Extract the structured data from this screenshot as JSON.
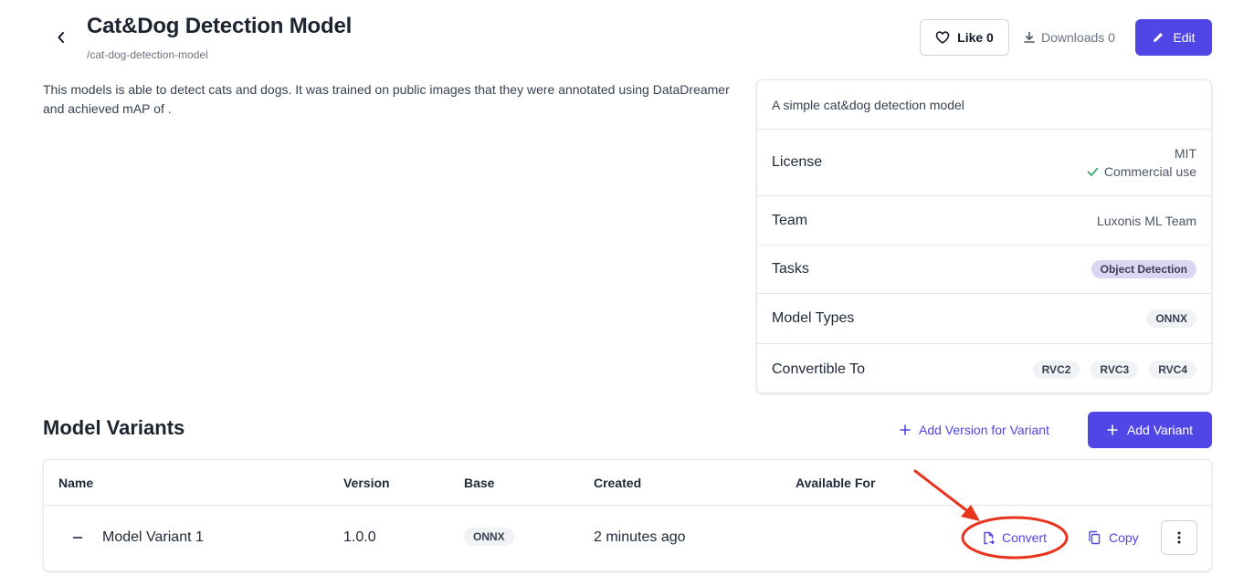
{
  "header": {
    "title": "Cat&Dog Detection Model",
    "slug": "/cat-dog-detection-model",
    "like_label": "Like 0",
    "downloads_label": "Downloads 0",
    "edit_label": "Edit"
  },
  "description": "This models is able to detect cats and dogs. It was trained on public images that they were annotated using DataDreamer and achieved mAP of .",
  "info": {
    "summary": "A simple cat&dog detection model",
    "license_label": "License",
    "license_value": "MIT",
    "commercial_use": "Commercial use",
    "team_label": "Team",
    "team_value": "Luxonis ML Team",
    "tasks_label": "Tasks",
    "tasks": [
      "Object Detection"
    ],
    "model_types_label": "Model Types",
    "model_types": [
      "ONNX"
    ],
    "convertible_label": "Convertible To",
    "convertible": [
      "RVC2",
      "RVC3",
      "RVC4"
    ]
  },
  "variants": {
    "title": "Model Variants",
    "add_version_label": "Add Version for Variant",
    "add_variant_label": "Add Variant",
    "columns": [
      "Name",
      "Version",
      "Base",
      "Created",
      "Available For"
    ],
    "rows": [
      {
        "name": "Model Variant 1",
        "version": "1.0.0",
        "base": "ONNX",
        "created": "2 minutes ago",
        "available_for": "",
        "convert_label": "Convert",
        "copy_label": "Copy"
      }
    ]
  },
  "colors": {
    "accent": "#4f46e5",
    "annotation": "#e8341c",
    "success": "#22a55a"
  }
}
